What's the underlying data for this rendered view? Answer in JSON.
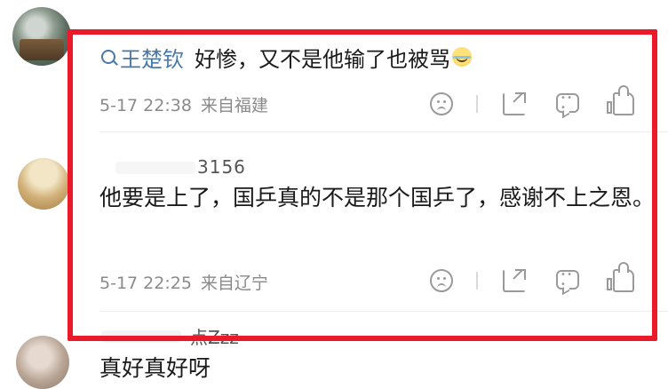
{
  "reply": {
    "mention": "王楚钦",
    "text": "好惨，又不是他输了也被骂",
    "emoji": "crying-laughing-emoji",
    "time": "5-17 22:38",
    "source": "来自福建"
  },
  "comment2": {
    "username": "3156",
    "text": "他要是上了，国乒真的不是那个国乒了，感谢不上之恩。",
    "time": "5-17 22:25",
    "source": "来自辽宁"
  },
  "comment3": {
    "username": "点Zzz",
    "text": "真好真好呀"
  },
  "icons": [
    "dislike-face-icon",
    "share-icon",
    "comment-icon",
    "like-icon"
  ],
  "colors": {
    "highlight_box": "#ea1a2a",
    "mention": "#4a78a6",
    "meta": "#8a8a8a"
  }
}
